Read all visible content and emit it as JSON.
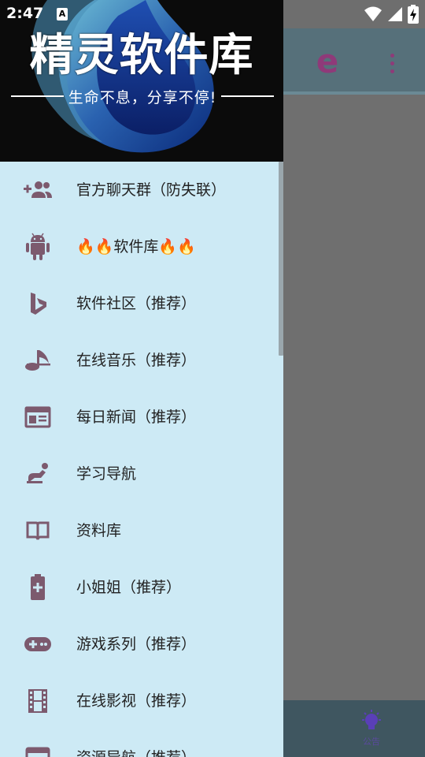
{
  "status_bar": {
    "time": "2:47",
    "notification_icon": "A"
  },
  "drawer": {
    "header": {
      "title": "精灵软件库",
      "subtitle": "生命不息，分享不停!"
    },
    "items": [
      {
        "label": "官方聊天群（防失联）",
        "icon": "group-add-icon"
      },
      {
        "label": "🔥🔥软件库🔥🔥",
        "icon": "android-icon"
      },
      {
        "label": "软件社区（推荐）",
        "icon": "bing-icon"
      },
      {
        "label": "在线音乐（推荐）",
        "icon": "music-note-icon"
      },
      {
        "label": "每日新闻（推荐）",
        "icon": "newspaper-icon"
      },
      {
        "label": "学习导航",
        "icon": "accessibility-icon"
      },
      {
        "label": "资料库",
        "icon": "book-icon"
      },
      {
        "label": "小姐姐（推荐）",
        "icon": "battery-plus-icon"
      },
      {
        "label": "游戏系列（推荐）",
        "icon": "gamepad-icon"
      },
      {
        "label": "在线影视（推荐）",
        "icon": "film-icon"
      },
      {
        "label": "资源导航（推荐）",
        "icon": "web-icon"
      }
    ]
  },
  "background": {
    "logo_letter": "e",
    "notice_label": "公告"
  },
  "colors": {
    "drawer_bg": "#cdeaf5",
    "icon": "#7c5a6e",
    "text": "#222222",
    "scrim": "#6f6f6f",
    "toolbar": "#56707a",
    "accent": "#8f3a79"
  }
}
